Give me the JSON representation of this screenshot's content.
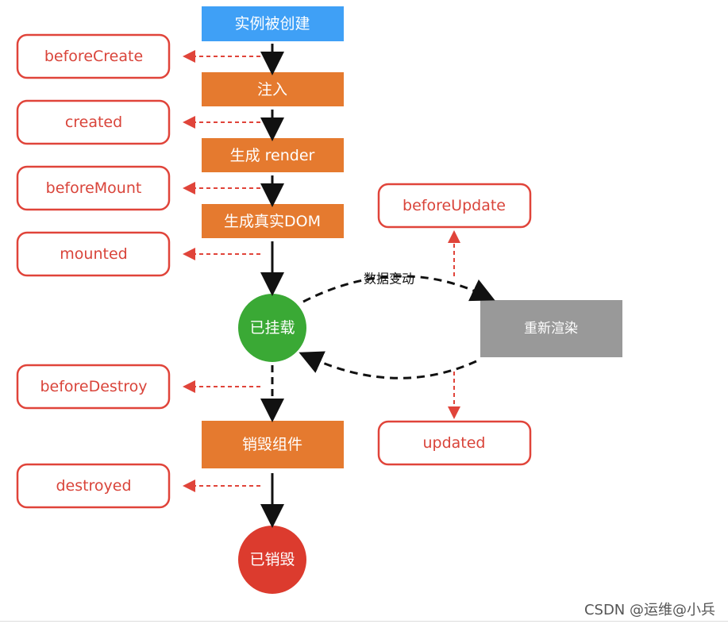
{
  "colors": {
    "created_step": "#3fa0f6",
    "step": "#e57a2f",
    "mounted_state": "#3aa935",
    "destroyed_state": "#dc3b2e",
    "rerender": "#999999",
    "hook_border": "#e0443a"
  },
  "steps": {
    "instance_created": "实例被创建",
    "inject": "注入",
    "render": "生成 render",
    "real_dom": "生成真实DOM",
    "destroy_component": "销毁组件",
    "rerender": "重新渲染",
    "data_change": "数据变动"
  },
  "states": {
    "mounted": "已挂载",
    "destroyed": "已销毁"
  },
  "hooks": {
    "beforeCreate": "beforeCreate",
    "created": "created",
    "beforeMount": "beforeMount",
    "mounted": "mounted",
    "beforeDestroy": "beforeDestroy",
    "destroyed": "destroyed",
    "beforeUpdate": "beforeUpdate",
    "updated": "updated"
  },
  "watermark": "CSDN @运维@小兵"
}
